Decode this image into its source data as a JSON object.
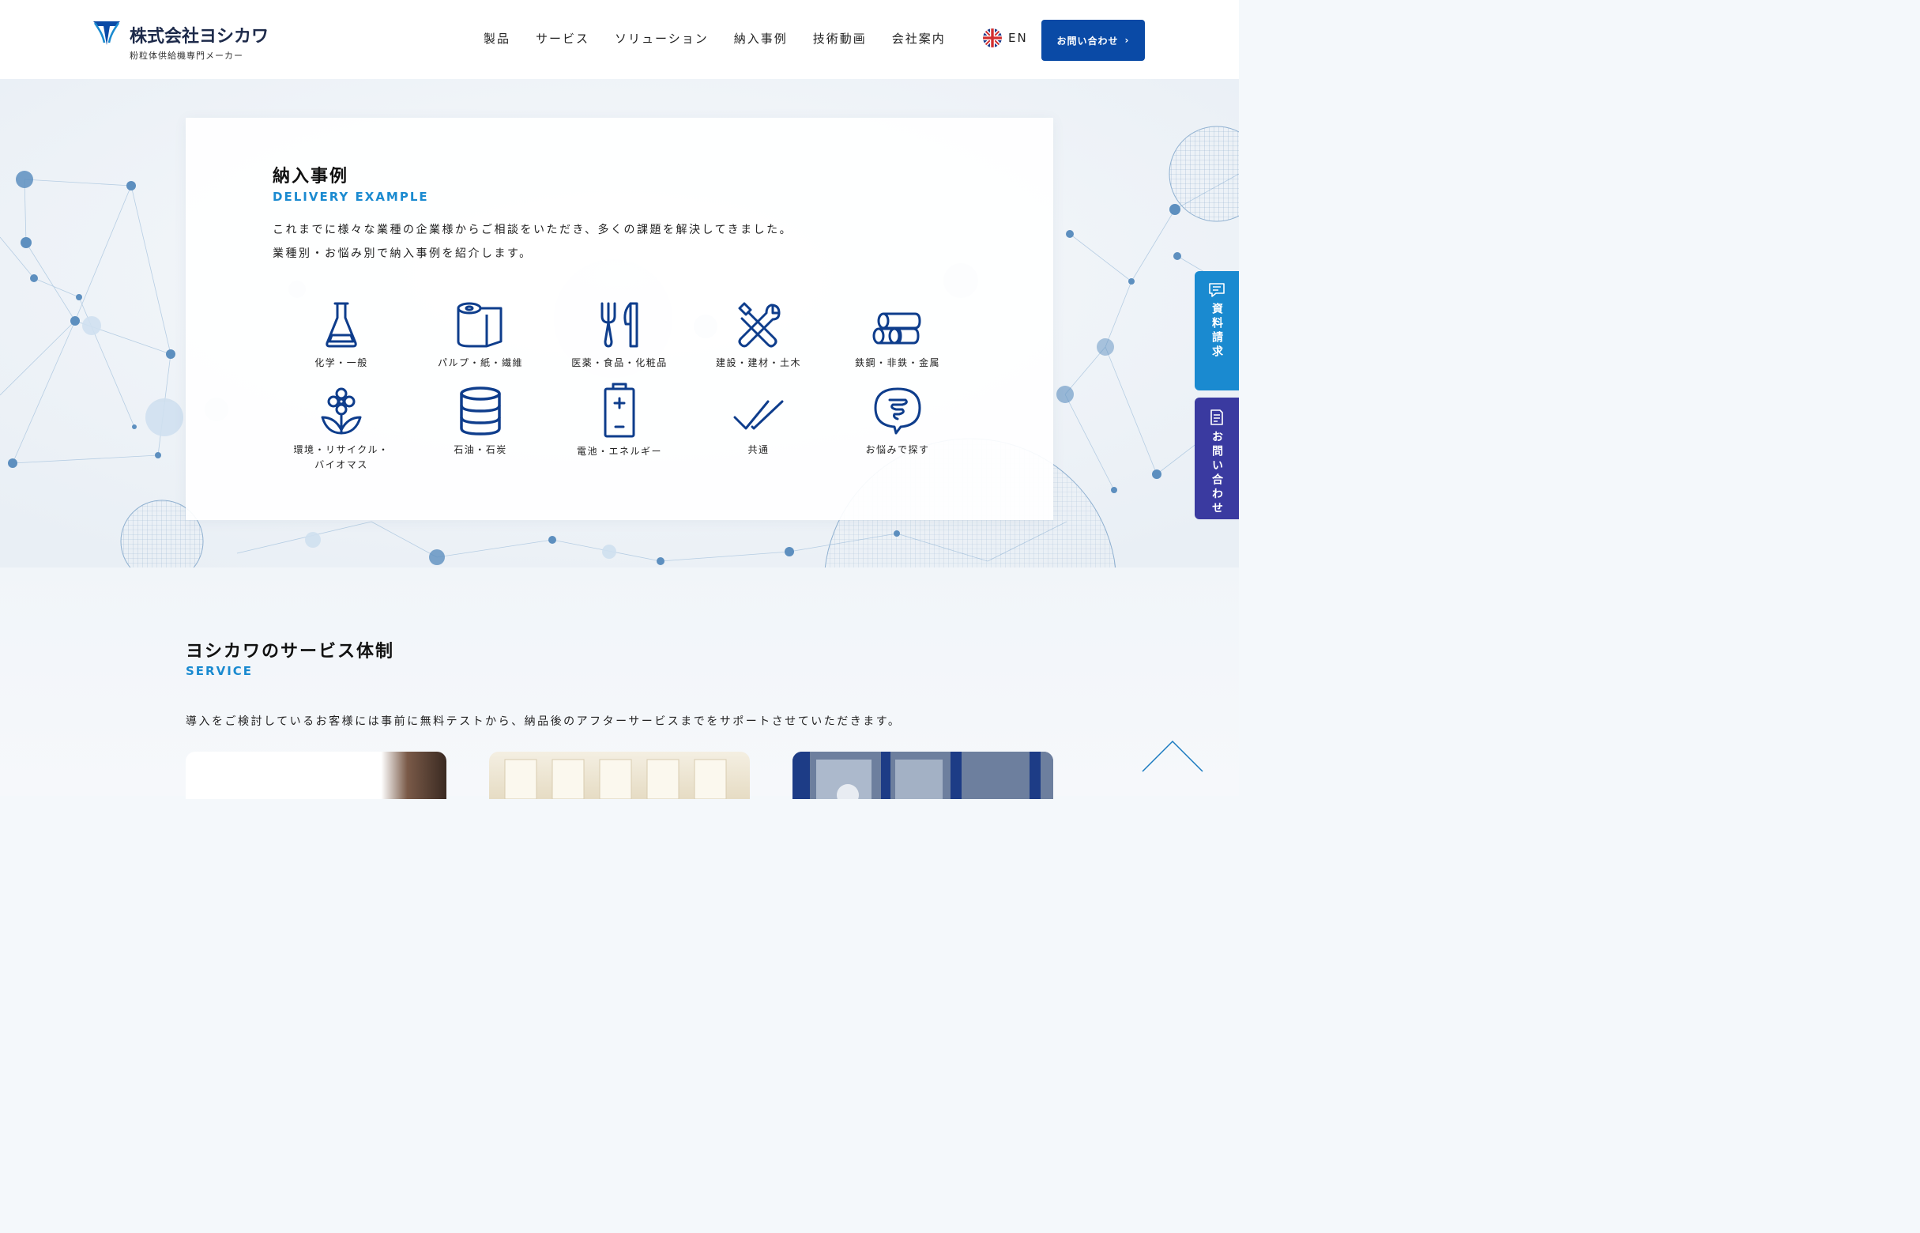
{
  "header": {
    "logo": {
      "company_name": "株式会社ヨシカワ",
      "tagline": "粉粒体供給機専門メーカー"
    },
    "nav": [
      {
        "label": "製品"
      },
      {
        "label": "サービス"
      },
      {
        "label": "ソリューション"
      },
      {
        "label": "納入事例"
      },
      {
        "label": "技術動画"
      },
      {
        "label": "会社案内"
      }
    ],
    "language": {
      "label": "EN",
      "icon": "uk-flag-icon"
    },
    "contact_button": {
      "label": "お問い合わせ",
      "icon": "chevron-right-icon"
    }
  },
  "delivery": {
    "title": "納入事例",
    "subtitle": "DELIVERY EXAMPLE",
    "description": [
      "これまでに様々な業種の企業様からご相談をいただき、多くの課題を解決してきました。",
      "業種別・お悩み別で納入事例を紹介します。"
    ],
    "categories": [
      {
        "label": "化学・一般",
        "icon": "flask-icon"
      },
      {
        "label": "パルプ・紙・繊維",
        "icon": "paper-roll-icon"
      },
      {
        "label": "医薬・食品・化粧品",
        "icon": "fork-knife-icon"
      },
      {
        "label": "建設・建材・土木",
        "icon": "tools-icon"
      },
      {
        "label": "鉄鋼・非鉄・金属",
        "icon": "steel-pipes-icon"
      },
      {
        "label": "環境・リサイクル・バイオマス",
        "label_line1": "環境・リサイクル・",
        "label_line2": "バイオマス",
        "icon": "flower-icon"
      },
      {
        "label": "石油・石炭",
        "icon": "oil-drum-icon"
      },
      {
        "label": "電池・エネルギー",
        "icon": "battery-icon"
      },
      {
        "label": "共通",
        "icon": "double-check-icon"
      },
      {
        "label": "お悩みで探す",
        "icon": "thought-bubble-icon"
      }
    ]
  },
  "side_tabs": {
    "document_request": {
      "label": "資料請求",
      "icon": "chat-doc-icon",
      "color": "#1a8ad0"
    },
    "inquiry": {
      "label": "お問い合わせ",
      "icon": "form-icon",
      "color": "#3a3aa0"
    }
  },
  "service": {
    "title": "ヨシカワのサービス体制",
    "subtitle": "SERVICE",
    "description": "導入をご検討しているお客様には事前に無料テストから、納品後のアフターサービスまでをサポートさせていただきます。"
  },
  "colors": {
    "brand_blue": "#0a4aa6",
    "accent_cyan": "#1a8ad0",
    "icon_navy": "#0e3d8c"
  },
  "page_top": {
    "icon": "page-top-arrow-icon"
  }
}
